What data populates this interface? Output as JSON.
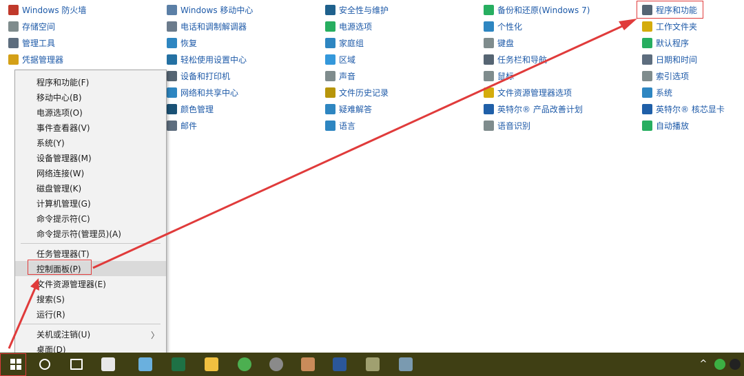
{
  "control_panel": {
    "columns": [
      [
        {
          "label": "Windows 防火墙",
          "icon": "firewall-icon",
          "color": "#c0392b"
        },
        {
          "label": "存储空间",
          "icon": "storage-icon",
          "color": "#7f8c8d"
        },
        {
          "label": "管理工具",
          "icon": "admin-tools-icon",
          "color": "#5d6d7e"
        },
        {
          "label": "凭据管理器",
          "icon": "credential-icon",
          "color": "#d4a017"
        }
      ],
      [
        {
          "label": "Windows 移动中心",
          "icon": "mobility-center-icon",
          "color": "#5b7fa6"
        },
        {
          "label": "电话和调制解调器",
          "icon": "phone-modem-icon",
          "color": "#6b7b8c"
        },
        {
          "label": "恢复",
          "icon": "recovery-icon",
          "color": "#2e86c1"
        },
        {
          "label": "轻松使用设置中心",
          "icon": "ease-of-access-icon",
          "color": "#2471a3"
        },
        {
          "label": "设备和打印机",
          "icon": "printer-icon",
          "color": "#566573"
        },
        {
          "label": "网络和共享中心",
          "icon": "network-icon",
          "color": "#2e86c1"
        },
        {
          "label": "颜色管理",
          "icon": "color-management-icon",
          "color": "#1a5276"
        },
        {
          "label": "邮件",
          "icon": "mail-icon",
          "color": "#5d6d7e"
        }
      ],
      [
        {
          "label": "安全性与维护",
          "icon": "flag-icon",
          "color": "#1f618d"
        },
        {
          "label": "电源选项",
          "icon": "power-icon",
          "color": "#27ae60"
        },
        {
          "label": "家庭组",
          "icon": "homegroup-icon",
          "color": "#2e86c1"
        },
        {
          "label": "区域",
          "icon": "region-icon",
          "color": "#3498db"
        },
        {
          "label": "声音",
          "icon": "sound-icon",
          "color": "#7f8c8d"
        },
        {
          "label": "文件历史记录",
          "icon": "file-history-icon",
          "color": "#b7950b"
        },
        {
          "label": "疑难解答",
          "icon": "troubleshoot-icon",
          "color": "#2e86c1"
        },
        {
          "label": "语言",
          "icon": "language-icon",
          "color": "#2e86c1"
        }
      ],
      [
        {
          "label": "备份和还原(Windows 7)",
          "icon": "backup-icon",
          "color": "#27ae60"
        },
        {
          "label": "个性化",
          "icon": "personalization-icon",
          "color": "#2e86c1"
        },
        {
          "label": "键盘",
          "icon": "keyboard-icon",
          "color": "#7f8c8d"
        },
        {
          "label": "任务栏和导航",
          "icon": "taskbar-icon",
          "color": "#566573"
        },
        {
          "label": "鼠标",
          "icon": "mouse-icon",
          "color": "#7f8c8d"
        },
        {
          "label": "文件资源管理器选项",
          "icon": "folder-options-icon",
          "color": "#d4ac0d"
        },
        {
          "label": "英特尔® 产品改善计划",
          "icon": "intel-icon",
          "color": "#1f5fa8"
        },
        {
          "label": "语音识别",
          "icon": "speech-icon",
          "color": "#7f8c8d"
        }
      ],
      [
        {
          "label": "程序和功能",
          "icon": "programs-features-icon",
          "color": "#566573"
        },
        {
          "label": "工作文件夹",
          "icon": "work-folders-icon",
          "color": "#d4ac0d"
        },
        {
          "label": "默认程序",
          "icon": "default-programs-icon",
          "color": "#27ae60"
        },
        {
          "label": "日期和时间",
          "icon": "clock-icon",
          "color": "#5d6d7e"
        },
        {
          "label": "索引选项",
          "icon": "indexing-icon",
          "color": "#7f8c8d"
        },
        {
          "label": "系统",
          "icon": "system-icon",
          "color": "#2e86c1"
        },
        {
          "label": "英特尔® 核芯显卡",
          "icon": "intel-graphics-icon",
          "color": "#1f5fa8"
        },
        {
          "label": "自动播放",
          "icon": "autoplay-icon",
          "color": "#27ae60"
        }
      ]
    ]
  },
  "context_menu": {
    "groups": [
      [
        "程序和功能(F)",
        "移动中心(B)",
        "电源选项(O)",
        "事件查看器(V)",
        "系统(Y)",
        "设备管理器(M)",
        "网络连接(W)",
        "磁盘管理(K)",
        "计算机管理(G)",
        "命令提示符(C)",
        "命令提示符(管理员)(A)"
      ],
      [
        "任务管理器(T)",
        "控制面板(P)",
        "文件资源管理器(E)",
        "搜索(S)",
        "运行(R)"
      ],
      [
        "关机或注销(U)",
        "桌面(D)"
      ]
    ],
    "submenu_arrow": "〉"
  },
  "colors": {
    "link": "#1e5aa8",
    "highlight_red": "#e03b3b",
    "taskbar": "#3f3f14",
    "menu_bg": "#f2f2f2"
  },
  "taskbar": {
    "items": [
      {
        "icon": "windows-start-icon",
        "color": "#ffffff"
      },
      {
        "icon": "search-icon",
        "color": "#ffffff"
      },
      {
        "icon": "task-view-icon",
        "color": "#ffffff"
      },
      {
        "icon": "fan-app-icon",
        "color": "#e8e8e8"
      },
      {
        "icon": "pen-app-icon",
        "color": "#6ab0de"
      },
      {
        "icon": "excel-icon",
        "color": "#1e7145"
      },
      {
        "icon": "file-explorer-icon",
        "color": "#f0c040"
      },
      {
        "icon": "360-browser-icon",
        "color": "#4caf50"
      },
      {
        "icon": "disk-app-icon",
        "color": "#8a8a8a"
      },
      {
        "icon": "mail-app-icon",
        "color": "#c98b5a"
      },
      {
        "icon": "word-icon",
        "color": "#2b579a"
      },
      {
        "icon": "tool-app-icon",
        "color": "#a0a070"
      },
      {
        "icon": "app-window-icon",
        "color": "#7a9ab0"
      }
    ],
    "tray": [
      {
        "icon": "chevron-up-icon",
        "glyph": "^"
      },
      {
        "icon": "green-status-icon",
        "color": "#3cb043"
      },
      {
        "icon": "qq-penguin-icon",
        "color": "#222222"
      }
    ]
  }
}
